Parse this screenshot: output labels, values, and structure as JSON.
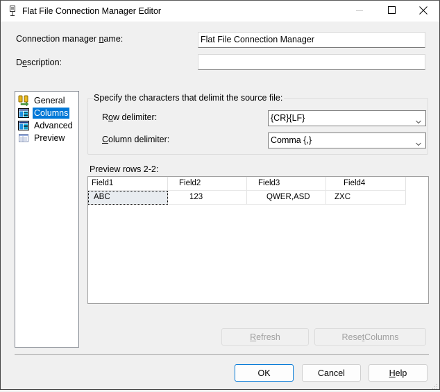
{
  "window": {
    "title": "Flat File Connection Manager Editor",
    "icon": "flat-file-connection-icon",
    "controls": {
      "minimize": "minimize-icon",
      "maximize": "maximize-icon",
      "close": "close-icon"
    }
  },
  "form": {
    "name_label_pre": "Connection manager ",
    "name_label_accel": "n",
    "name_label_post": "ame:",
    "name_value": "Flat File Connection Manager",
    "description_label_pre": "D",
    "description_label_accel": "e",
    "description_label_post": "scription:",
    "description_value": ""
  },
  "nav": {
    "items": [
      {
        "label": "General",
        "icon": "general-icon",
        "selected": false
      },
      {
        "label": "Columns",
        "icon": "columns-icon",
        "selected": true
      },
      {
        "label": "Advanced",
        "icon": "advanced-icon",
        "selected": false
      },
      {
        "label": "Preview",
        "icon": "preview-icon",
        "selected": false
      }
    ]
  },
  "delimiters": {
    "group_label": "Specify the characters that delimit the source file:",
    "row_label_pre": "R",
    "row_label_accel": "o",
    "row_label_post": "w delimiter:",
    "row_value": "{CR}{LF}",
    "column_label_accel": "C",
    "column_label_post": "olumn delimiter:",
    "column_value": "Comma {,}"
  },
  "preview": {
    "label": "Preview rows 2-2:",
    "columns": [
      "Field1",
      "Field2",
      "Field3",
      "Field4"
    ],
    "rows": [
      [
        "ABC",
        "123",
        "QWER,ASD",
        "ZXC"
      ]
    ]
  },
  "actions": {
    "refresh_accel": "R",
    "refresh_post": "efresh",
    "reset_pre": "Rese",
    "reset_accel": "t",
    "reset_post": " Columns",
    "ok": "OK",
    "cancel": "Cancel",
    "help_accel": "H",
    "help_post": "elp"
  }
}
